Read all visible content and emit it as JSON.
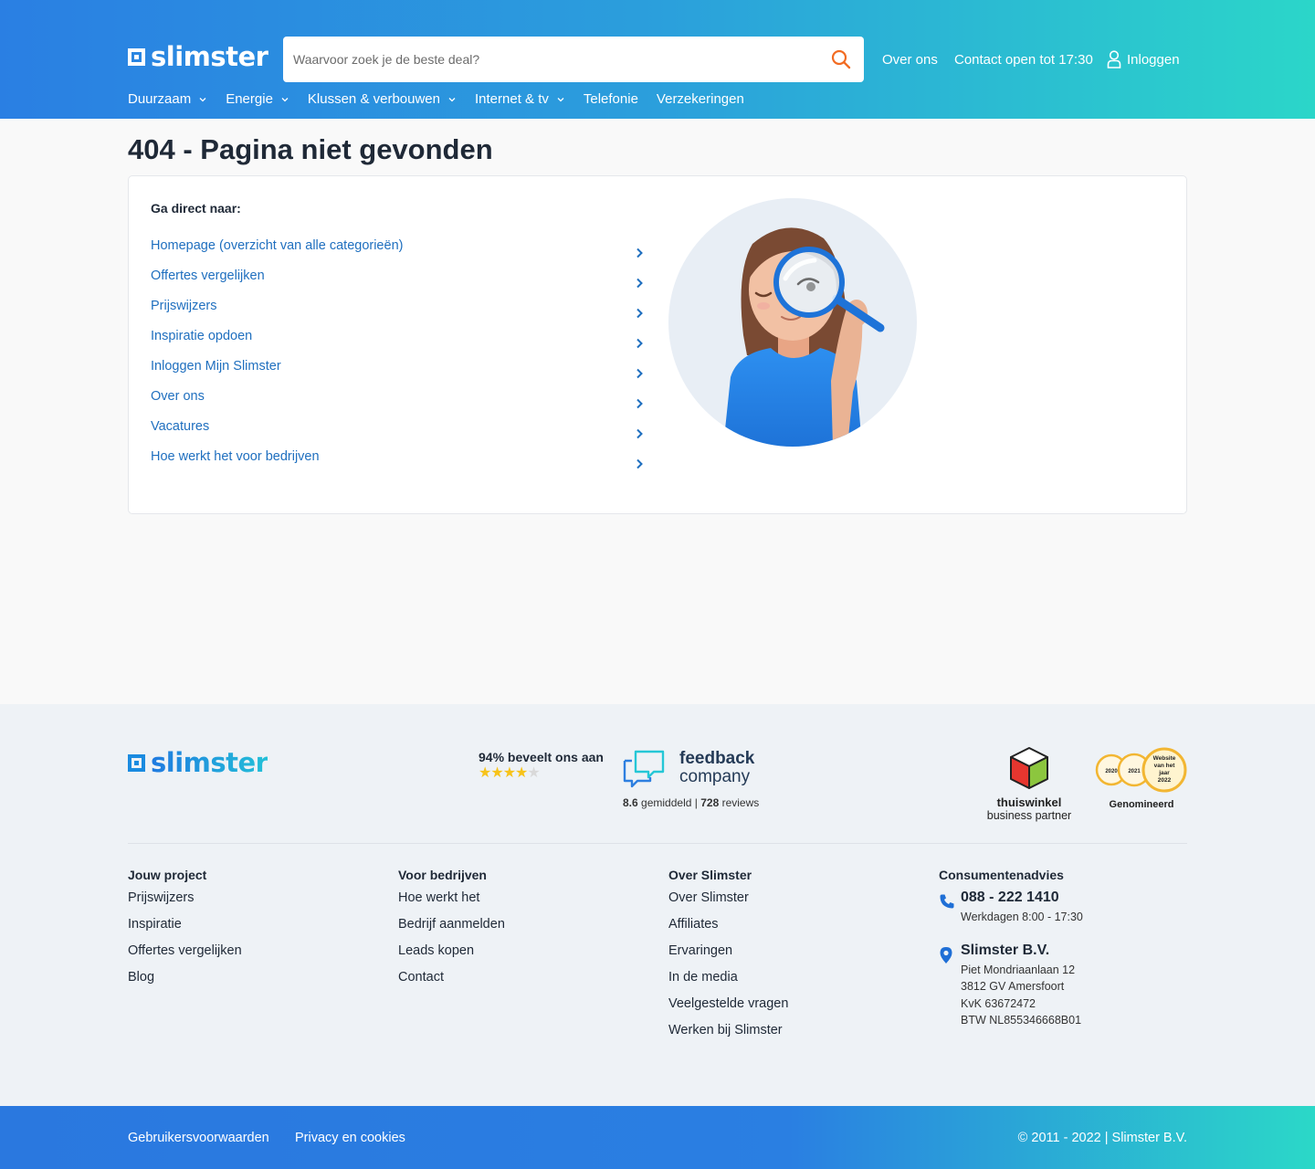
{
  "header": {
    "logo_text": "slimster",
    "search": {
      "placeholder": "Waarvoor zoek je de beste deal?"
    },
    "links": {
      "about": "Over ons",
      "contact": "Contact open tot 17:30",
      "login": "Inloggen"
    },
    "nav": [
      {
        "label": "Duurzaam",
        "has_dropdown": true
      },
      {
        "label": "Energie",
        "has_dropdown": true
      },
      {
        "label": "Klussen & verbouwen",
        "has_dropdown": true
      },
      {
        "label": "Internet & tv",
        "has_dropdown": true
      },
      {
        "label": "Telefonie",
        "has_dropdown": false
      },
      {
        "label": "Verzekeringen",
        "has_dropdown": false
      }
    ]
  },
  "main": {
    "title": "404 - Pagina niet gevonden",
    "card_heading": "Ga direct naar:",
    "links": [
      "Homepage (overzicht van alle categorieën)",
      "Offertes vergelijken",
      "Prijswijzers",
      "Inspiratie opdoen",
      "Inloggen Mijn Slimster",
      "Over ons",
      "Vacatures",
      "Hoe werkt het voor bedrijven"
    ]
  },
  "footer": {
    "logo_text": "slimster",
    "recommend": "94% beveelt ons aan",
    "rating_stars": 4,
    "rating_stars_max": 5,
    "feedback": {
      "line1": "feedback",
      "line2": "company",
      "score": "8.6",
      "score_label": "gemiddeld",
      "separator": "|",
      "reviews": "728",
      "reviews_label": "reviews"
    },
    "thuiswinkel": {
      "line1": "thuiswinkel",
      "line2": "business partner"
    },
    "award": {
      "years": [
        "2020",
        "2021"
      ],
      "badge_lines": [
        "Website",
        "van het",
        "jaar",
        "2022"
      ],
      "label": "Genomineerd"
    },
    "columns": [
      {
        "title": "Jouw project",
        "items": [
          "Prijswijzers",
          "Inspiratie",
          "Offertes vergelijken",
          "Blog"
        ]
      },
      {
        "title": "Voor bedrijven",
        "items": [
          "Hoe werkt het",
          "Bedrijf aanmelden",
          "Leads kopen",
          "Contact"
        ]
      },
      {
        "title": "Over Slimster",
        "items": [
          "Over Slimster",
          "Affiliates",
          "Ervaringen",
          "In de media",
          "Veelgestelde vragen",
          "Werken bij Slimster"
        ]
      }
    ],
    "contact": {
      "title": "Consumentenadvies",
      "phone": "088 - 222 1410",
      "hours": "Werkdagen 8:00 - 17:30",
      "company": "Slimster B.V.",
      "address_lines": [
        "Piet Mondriaanlaan 12",
        "3812 GV Amersfoort",
        "KvK 63672472",
        "BTW NL855346668B01"
      ]
    },
    "bottom": {
      "terms": "Gebruikersvoorwaarden",
      "privacy": "Privacy en cookies",
      "copyright": "© 2011 - 2022 | Slimster B.V."
    }
  },
  "colors": {
    "link": "#1f6fbf",
    "accent_orange": "#f26c23",
    "gradient_start": "#2a7fe3",
    "gradient_end": "#2bd6c9",
    "star": "#f7c31a"
  }
}
